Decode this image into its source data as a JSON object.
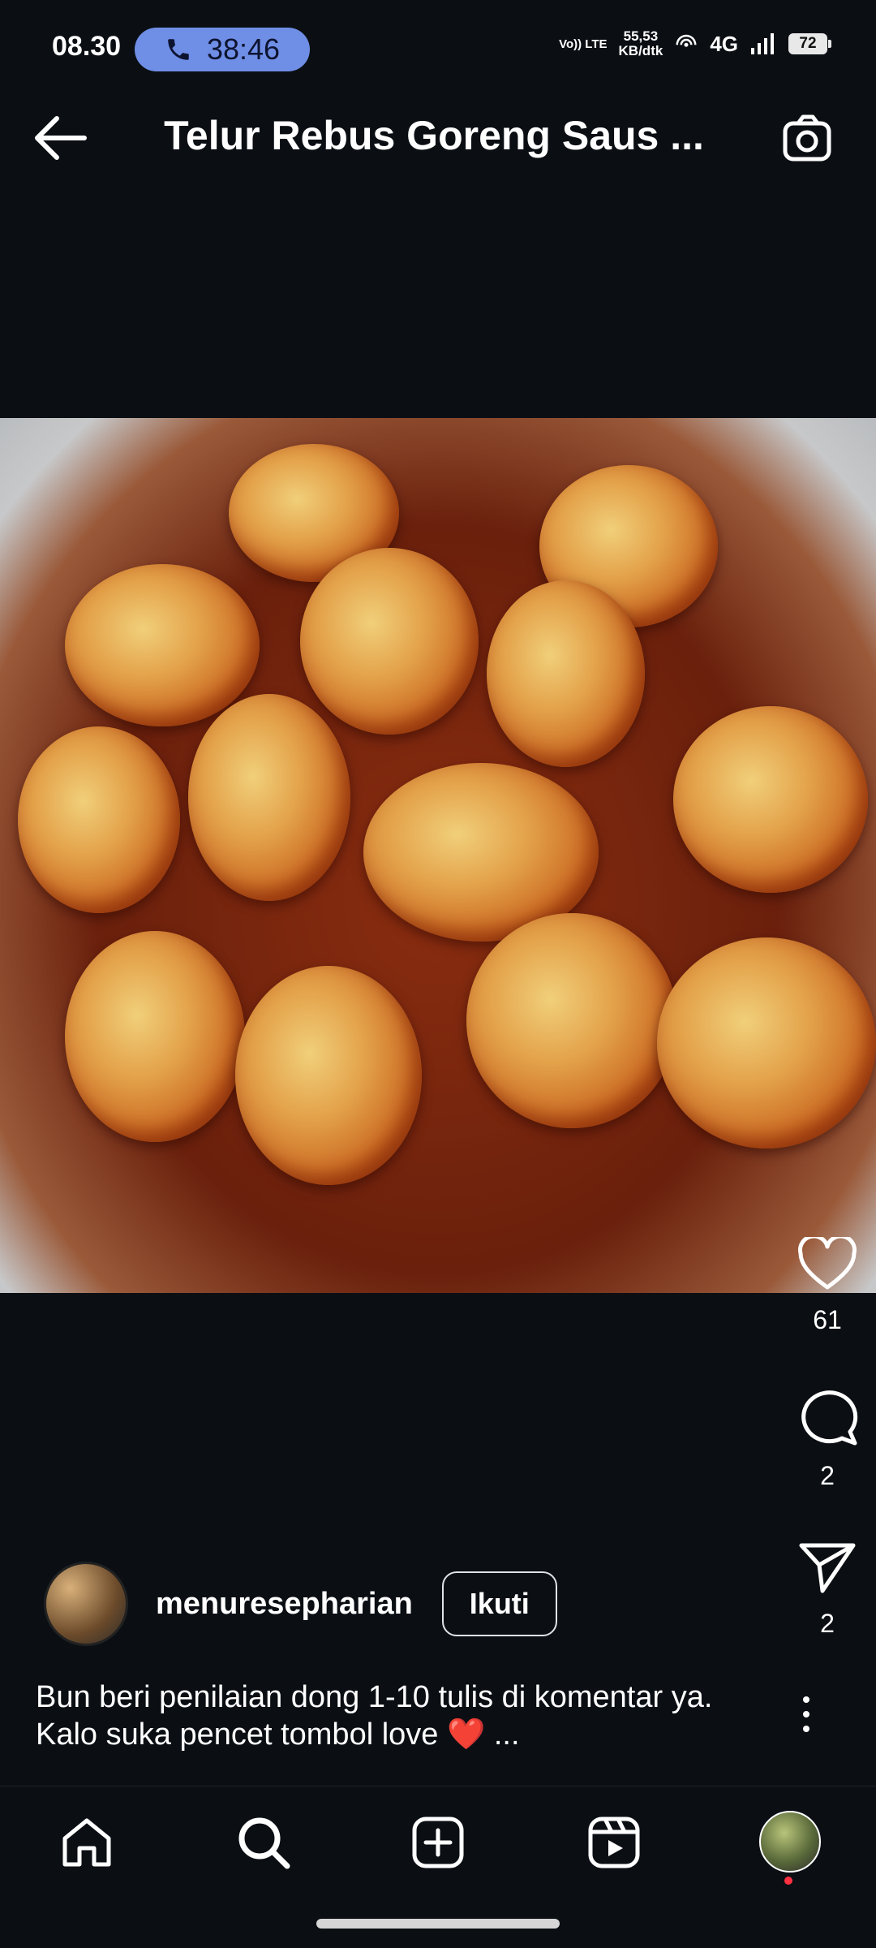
{
  "status_bar": {
    "time": "08.30",
    "call_duration": "38:46",
    "volte": "Vo)) LTE",
    "speed_value": "55,53",
    "speed_unit": "KB/dtk",
    "network": "4G",
    "battery": "72"
  },
  "header": {
    "title": "Telur Rebus Goreng Saus ..."
  },
  "post": {
    "likes": "61",
    "comments": "2",
    "shares": "2",
    "username": "menuresepharian",
    "follow_label": "Ikuti",
    "caption_line1": "Bun beri penilaian dong 1-10 tulis di komentar ya.",
    "caption_line2": "Kalo suka pencet tombol love ❤️ ..."
  },
  "icons": {
    "back": "arrow-left-icon",
    "camera": "camera-icon",
    "like": "heart-icon",
    "comment": "comment-icon",
    "share": "send-icon",
    "more": "more-vertical-icon",
    "home": "home-icon",
    "search": "search-icon",
    "create": "plus-square-icon",
    "reels": "reels-icon",
    "profile": "profile-avatar"
  },
  "colors": {
    "background": "#0b0f14",
    "call_pill": "#6f8ee6",
    "notification_dot": "#ff3040"
  }
}
